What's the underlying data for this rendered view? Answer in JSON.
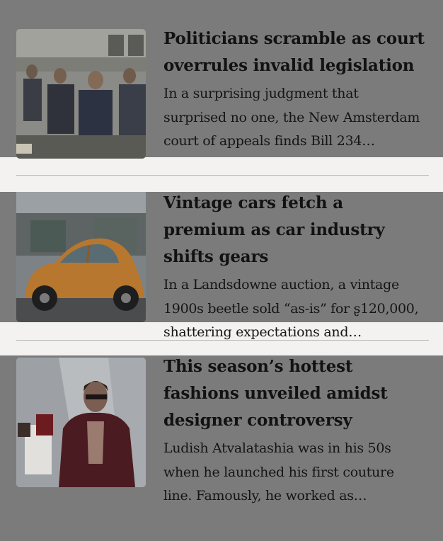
{
  "articles": [
    {
      "image_icon": "meeting-photo",
      "headline": "Politicians scramble as court overrules invalid legislation",
      "excerpt": "In a surprising judgment that surprised no one, the New Amsterdam court of appeals finds Bill 234…"
    },
    {
      "image_icon": "vintage-car-photo",
      "headline": "Vintage cars fetch a premium as car industry shifts gears",
      "excerpt": "In a Landsdowne auction, a vintage 1900s beetle sold “as-is” for ʂ120,000, shattering expectations and…"
    },
    {
      "image_icon": "fashion-photo",
      "headline": "This season’s hottest fashions unveiled amidst designer controversy",
      "excerpt": "Ludish Atvalatashia was in his 50s when he launched his first couture line. Famously, he worked as…"
    }
  ],
  "colors": {
    "page_background": "#f3f2f0",
    "overlay_gray": "#7b7b7b",
    "divider": "#b9b8b5",
    "headline_text": "#121212"
  }
}
